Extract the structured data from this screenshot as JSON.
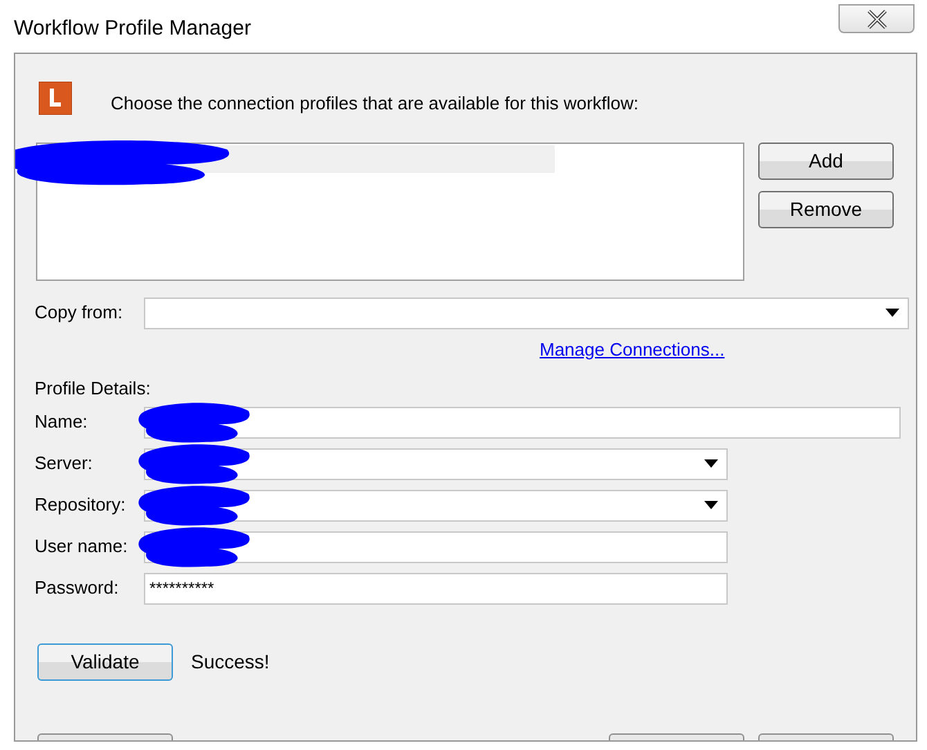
{
  "window": {
    "title": "Workflow Profile Manager"
  },
  "instruction": "Choose the connection profiles that are available for this workflow:",
  "profiles": [
    {
      "selected": true,
      "redacted": true
    }
  ],
  "list_buttons": [
    "Add",
    "Remove"
  ],
  "copy_from": {
    "label": "Copy from:"
  },
  "manage_link": "Manage Connections...",
  "section_title": "Profile Details:",
  "fields": [
    {
      "label": "Name:",
      "kind": "text",
      "wide": true,
      "redacted": true
    },
    {
      "label": "Server:",
      "kind": "dropdown",
      "wide": false,
      "redacted": true
    },
    {
      "label": "Repository:",
      "kind": "dropdown",
      "wide": false,
      "redacted": true
    },
    {
      "label": "User name:",
      "kind": "text",
      "wide": false,
      "redacted": true
    },
    {
      "label": "Password:",
      "kind": "text",
      "wide": false,
      "redacted": false,
      "value": "**********"
    }
  ],
  "validate_button": "Validate",
  "status": "Success!",
  "footer_buttons": [
    {
      "kind": "cut-off"
    },
    {
      "kind": "cut-off"
    },
    {
      "kind": "cut-off"
    }
  ]
}
